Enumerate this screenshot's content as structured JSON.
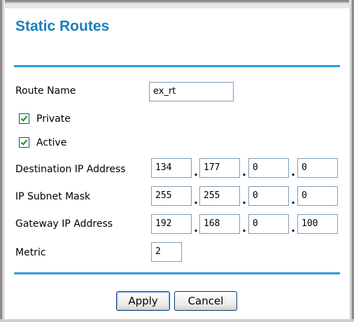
{
  "page": {
    "title": "Static Routes"
  },
  "form": {
    "route_name": {
      "label": "Route Name",
      "value": "ex_rt"
    },
    "private": {
      "label": "Private",
      "checked": true
    },
    "active": {
      "label": "Active",
      "checked": true
    },
    "destination_ip": {
      "label": "Destination IP Address",
      "octets": [
        "134",
        "177",
        "0",
        "0"
      ]
    },
    "subnet_mask": {
      "label": "IP Subnet Mask",
      "octets": [
        "255",
        "255",
        "0",
        "0"
      ]
    },
    "gateway_ip": {
      "label": "Gateway IP Address",
      "octets": [
        "192",
        "168",
        "0",
        "100"
      ]
    },
    "metric": {
      "label": "Metric",
      "value": "2"
    },
    "separator": "."
  },
  "buttons": {
    "apply": "Apply",
    "cancel": "Cancel"
  },
  "colors": {
    "accent": "#2a9fd3",
    "title": "#1a7fb8",
    "check": "#008000"
  }
}
